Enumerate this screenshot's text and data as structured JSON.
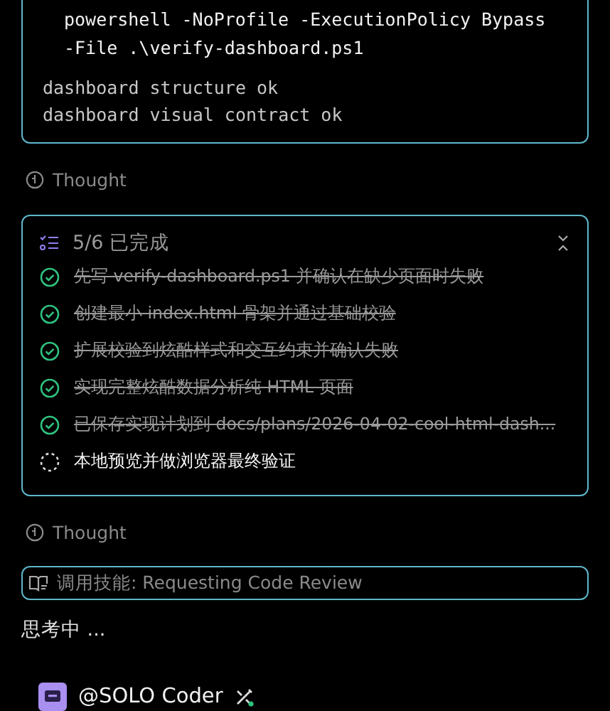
{
  "command_card": {
    "command_lines": [
      "powershell -NoProfile -ExecutionPolicy Bypass",
      "-File .\\verify-dashboard.ps1"
    ],
    "output_lines": [
      "dashboard structure ok",
      "dashboard visual contract ok"
    ]
  },
  "thought_1": {
    "label": "Thought"
  },
  "todo": {
    "title": "5/6 已完成",
    "expanded": true,
    "items": [
      {
        "text": "先写 verify-dashboard.ps1 并确认在缺少页面时失败",
        "done": true
      },
      {
        "text": "创建最小 index.html 骨架并通过基础校验",
        "done": true
      },
      {
        "text": "扩展校验到炫酷样式和交互约束并确认失败",
        "done": true
      },
      {
        "text": "实现完整炫酷数据分析纯 HTML 页面",
        "done": true
      },
      {
        "text": "已保存实现计划到 docs/plans/2026-04-02-cool-html-dash...",
        "done": true
      },
      {
        "text": "本地预览并做浏览器最终验证",
        "done": false
      }
    ]
  },
  "thought_2": {
    "label": "Thought"
  },
  "skill": {
    "label": "调用技能: Requesting Code Review"
  },
  "status": "思考中 ...",
  "agent": {
    "name": "@SOLO Coder"
  }
}
